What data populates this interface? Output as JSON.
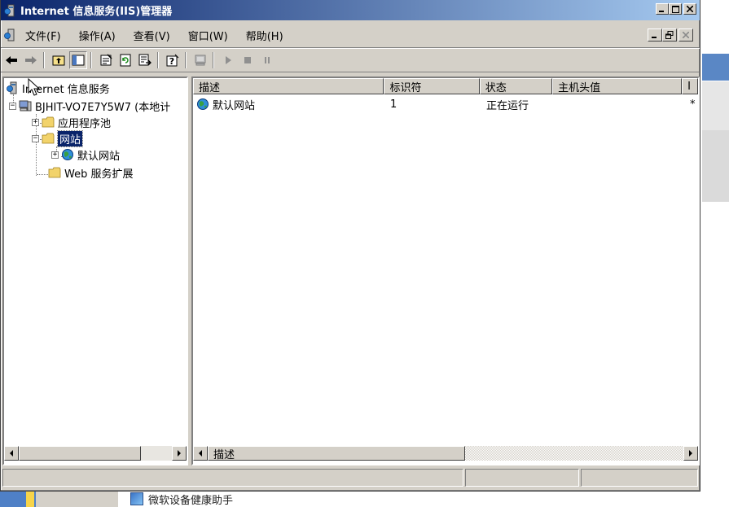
{
  "window": {
    "title": "Internet 信息服务(IIS)管理器"
  },
  "menu": {
    "items": [
      "文件(F)",
      "操作(A)",
      "查看(V)",
      "窗口(W)",
      "帮助(H)"
    ]
  },
  "toolbar": {
    "icons": [
      "back-arrow-icon",
      "forward-arrow-icon",
      "up-folder-icon",
      "show-hide-tree-icon",
      "properties-icon",
      "refresh-icon",
      "export-list-icon",
      "help-icon",
      "computer-icon",
      "play-icon",
      "stop-icon",
      "pause-icon"
    ]
  },
  "tree": {
    "root": "Internet 信息服务",
    "computer": "BJHIT-VO7E7Y5W7 (本地计",
    "app_pools": "应用程序池",
    "websites": "网站",
    "default_site": "默认网站",
    "web_ext": "Web 服务扩展"
  },
  "list": {
    "columns": [
      "描述",
      "标识符",
      "状态",
      "主机头值",
      "I"
    ],
    "rows": [
      {
        "desc": "默认网站",
        "id": "1",
        "status": "正在运行",
        "host": "",
        "ip": "*"
      }
    ]
  },
  "scroll": {
    "right_header": "描述"
  },
  "taskbar": {
    "helper": "微软设备健康助手"
  },
  "colors": {
    "title_start": "#0a246a",
    "title_end": "#a6caf0",
    "face": "#d4d0c8",
    "selection": "#0a246a"
  }
}
